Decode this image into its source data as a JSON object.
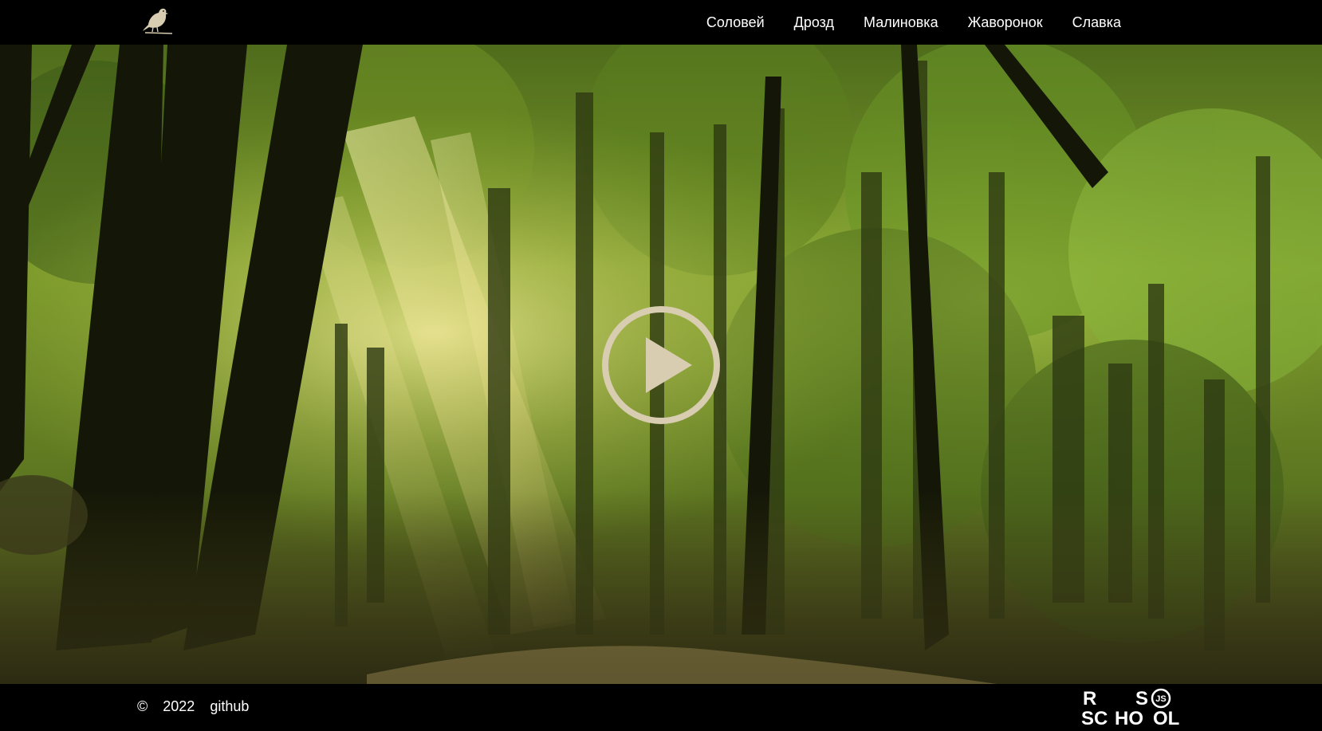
{
  "header": {
    "logo_icon": "bird-icon",
    "nav": [
      {
        "label": "Соловей"
      },
      {
        "label": "Дрозд"
      },
      {
        "label": "Малиновка"
      },
      {
        "label": "Жаворонок"
      },
      {
        "label": "Славка"
      }
    ]
  },
  "hero": {
    "background": "forest-sunlight-image",
    "play_icon": "play-icon"
  },
  "footer": {
    "copyright_symbol": "©",
    "year": "2022",
    "link_label": "github",
    "school_logo": {
      "icon": "rs-school-logo",
      "line1_left": "R",
      "line1_right": "S",
      "line2_left": "SC",
      "line2_mid": "HO",
      "line2_right": "OL",
      "badge": "JS"
    }
  },
  "colors": {
    "bar_background": "#000000",
    "text": "#ffffff",
    "play_button": "#d8cdb0"
  }
}
